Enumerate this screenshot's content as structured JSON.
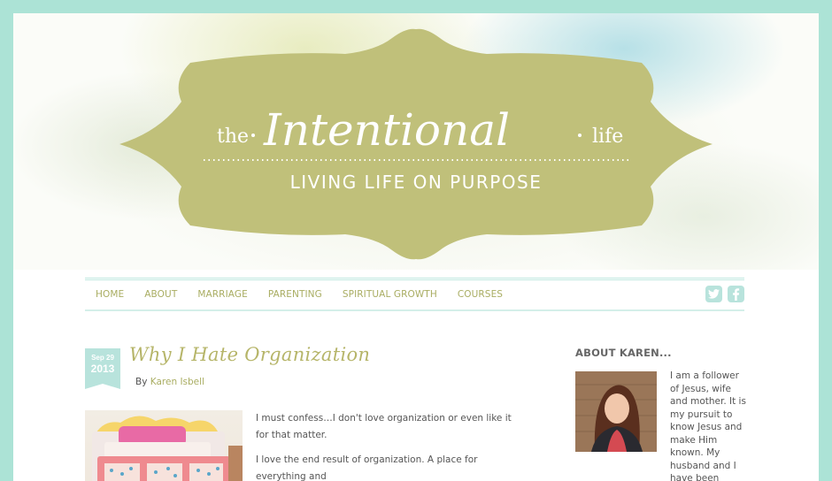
{
  "header": {
    "title_prefix": "the",
    "title_main": "Intentional",
    "title_suffix": "life",
    "tagline": "LIVING LIFE ON PURPOSE",
    "colors": {
      "plaque": "#c0c07a",
      "text": "#ffffff",
      "frame": "#ace3d6"
    }
  },
  "nav": {
    "items": [
      "HOME",
      "ABOUT",
      "MARRIAGE",
      "PARENTING",
      "SPIRITUAL GROWTH",
      "COURSES"
    ],
    "social": {
      "twitter_icon": "twitter-icon",
      "facebook_icon": "facebook-icon"
    }
  },
  "post": {
    "date_md": "Sep 29",
    "date_year": "2013",
    "title": "Why I Hate Organization",
    "by": "By",
    "author": "Karen Isbell",
    "paragraphs": [
      "I must confess…I don't love organization or even like it for that matter.",
      "I love the end result of organization. A place for everything and"
    ]
  },
  "sidebar": {
    "title": "ABOUT KAREN...",
    "bio": "I am a follower of Jesus, wife and mother. It is my pursuit to know Jesus and make Him known. My husband and I have been"
  }
}
